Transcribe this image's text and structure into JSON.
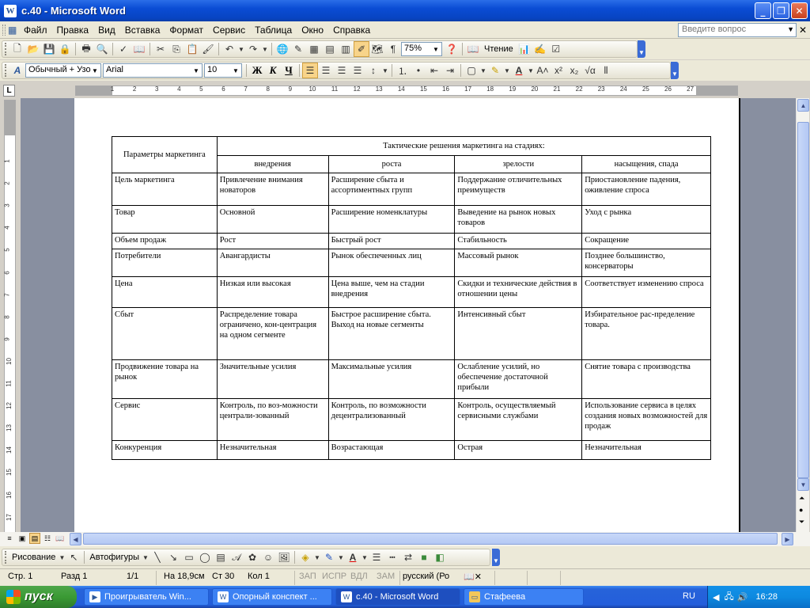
{
  "window": {
    "title": "c.40 - Microsoft Word",
    "app_icon": "W"
  },
  "menu": {
    "items": [
      "Файл",
      "Правка",
      "Вид",
      "Вставка",
      "Формат",
      "Сервис",
      "Таблица",
      "Окно",
      "Справка"
    ],
    "help_placeholder": "Введите вопрос"
  },
  "toolbar": {
    "zoom": "75%",
    "reading_label": "Чтение"
  },
  "formatting": {
    "style": "Обычный + Узо",
    "font": "Arial",
    "size": "10"
  },
  "ruler": {
    "h_numbers": [
      "1",
      "2",
      "3",
      "4",
      "5",
      "6",
      "7",
      "8",
      "9",
      "10",
      "11",
      "12",
      "13",
      "14",
      "15",
      "16",
      "17",
      "18",
      "19",
      "20",
      "21",
      "22",
      "23",
      "24",
      "25",
      "26",
      "27"
    ],
    "v_numbers": [
      "1",
      "2",
      "3",
      "4",
      "5",
      "6",
      "7",
      "8",
      "9",
      "10",
      "11",
      "12",
      "13",
      "14",
      "15",
      "16",
      "17"
    ]
  },
  "table": {
    "param_header": "Параметры маркетинга",
    "group_header": "Тактические решения маркетинга на стадиях:",
    "stages": [
      "внедрения",
      "роста",
      "зрелости",
      "насыщения, спада"
    ],
    "rows": [
      {
        "param": "Цель маркетинга",
        "cells": [
          "Привлечение внимания новаторов",
          "Расширение сбыта и ассортиментных групп",
          "Поддержание отличительных преимуществ",
          "Приостановление падения, оживление спроса"
        ]
      },
      {
        "param": "Товар",
        "cells": [
          "Основной",
          "Расширение номенклатуры",
          "Выведение на рынок новых товаров",
          "Уход с рынка"
        ]
      },
      {
        "param": "Объем продаж",
        "cells": [
          "Рост",
          "Быстрый рост",
          "Стабильность",
          "Сокращение"
        ]
      },
      {
        "param": "Потребители",
        "cells": [
          "Авангардисты",
          "Рынок обеспеченных лиц",
          "Массовый рынок",
          "Позднее большинство, консерваторы"
        ]
      },
      {
        "param": "Цена",
        "cells": [
          "Низкая или высокая",
          "Цена выше, чем на стадии внедрения",
          "Скидки и технические действия в отношении цены",
          "Соответствует изменению спроса"
        ]
      },
      {
        "param": "Сбыт",
        "cells": [
          "Распределение товара ограничено, кон-центрация на одном сегменте",
          "Быстрое расширение сбыта. Выход на новые сегменты",
          "Интенсивный сбыт",
          "Избирательное рас-пределение товара."
        ]
      },
      {
        "param": "Продвижение товара на рынок",
        "cells": [
          "Значительные усилия",
          "Максимальные усилия",
          "Ослабление усилий, но обеспечение достаточной прибыли",
          "Снятие товара с производства"
        ]
      },
      {
        "param": "Сервис",
        "cells": [
          "Контроль, по воз-можности централи-зованный",
          "Контроль, по возможности децентрализованный",
          "Контроль, осуществляемый сервисными службами",
          "Использование сервиса в целях создания новых возможностей для продаж"
        ]
      },
      {
        "param": "Конкуренция",
        "cells": [
          "Незначительная",
          "Возрастающая",
          "Острая",
          "Незначительная"
        ]
      }
    ]
  },
  "drawing": {
    "drawing_label": "Рисование",
    "autoshapes_label": "Автофигуры"
  },
  "status": {
    "page": "Стр. 1",
    "section": "Разд 1",
    "pages": "1/1",
    "at": "На 18,9см",
    "line": "Ст 30",
    "col": "Кол 1",
    "rec": "ЗАП",
    "trk": "ИСПР",
    "ext": "ВДЛ",
    "ovr": "ЗАМ",
    "language": "русский (Ро"
  },
  "taskbar": {
    "start_label": "пуск",
    "tasks": [
      "Проигрыватель Win...",
      "Опорный конспект ...",
      "c.40 - Microsoft Word",
      "Стафеева"
    ],
    "lang": "RU",
    "clock": "16:28"
  }
}
